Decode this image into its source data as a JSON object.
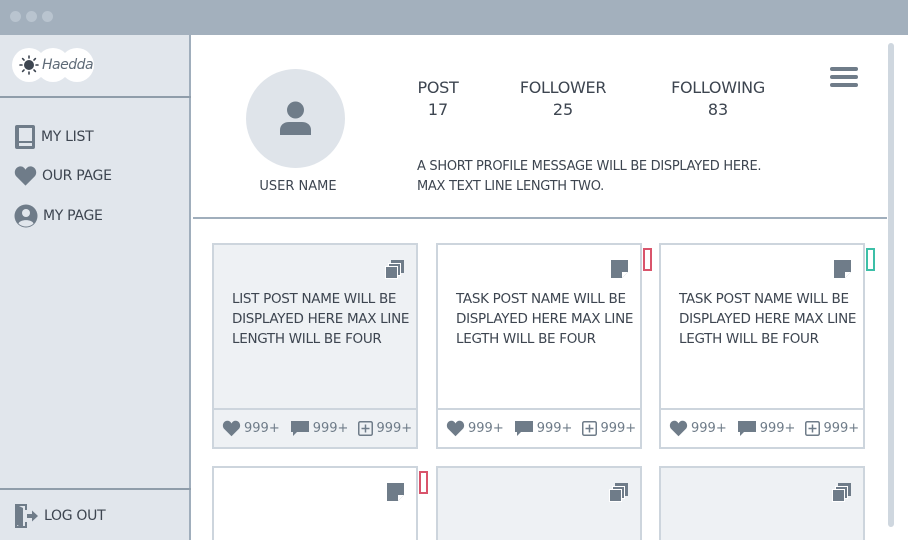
{
  "logo": {
    "text": "Haedda",
    "icon": "sun-icon"
  },
  "sidebar": {
    "items": [
      {
        "label": "MY LIST",
        "icon": "book-icon"
      },
      {
        "label": "OUR PAGE",
        "icon": "heart-icon"
      },
      {
        "label": "MY PAGE",
        "icon": "user-circle-icon"
      }
    ],
    "logout": {
      "label": "LOG OUT",
      "icon": "logout-door-icon"
    }
  },
  "profile": {
    "username": "USER NAME",
    "stats": [
      {
        "label": "POST",
        "value": "17"
      },
      {
        "label": "FOLLOWER",
        "value": "25"
      },
      {
        "label": "FOLLOWING",
        "value": "83"
      }
    ],
    "message_lines": [
      "A SHORT PROFILE MESSAGE WILL BE DISPLAYED HERE.",
      "MAX TEXT LINE LENGTH TWO."
    ]
  },
  "cards": [
    {
      "type": "list",
      "title": "LIST POST NAME WILL BE DISPLAYED HERE MAX LINE LENGTH WILL BE FOUR",
      "likes": "999+",
      "comments": "999+",
      "adds": "999+",
      "flag": ""
    },
    {
      "type": "task",
      "title": "TASK POST NAME WILL BE DISPLAYED HERE MAX LINE LEGTH WILL BE FOUR",
      "likes": "999+",
      "comments": "999+",
      "adds": "999+",
      "flag": "red"
    },
    {
      "type": "task",
      "title": "TASK POST NAME WILL BE DISPLAYED HERE MAX LINE LEGTH WILL BE FOUR",
      "likes": "999+",
      "comments": "999+",
      "adds": "999+",
      "flag": "green"
    },
    {
      "type": "task",
      "title": "",
      "flag": "red"
    },
    {
      "type": "list",
      "title": "",
      "flag": ""
    },
    {
      "type": "list",
      "title": "",
      "flag": ""
    }
  ],
  "colors": {
    "titlebar": "#a3b0bd",
    "sidebar": "#e1e6ec",
    "icon": "#6f7c89",
    "text": "#3d4550",
    "flag_red": "#d9546b",
    "flag_green": "#3cbfa7"
  }
}
